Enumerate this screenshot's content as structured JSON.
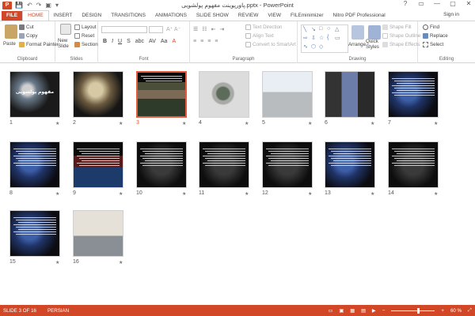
{
  "window": {
    "title": "پاورپوینت مفهوم پولشویی.pptx - PowerPoint",
    "app_badge": "P",
    "signin": "Sign in",
    "controls": [
      "?",
      "▭",
      "—",
      "▢",
      "✕"
    ]
  },
  "qat": [
    "💾",
    "↶",
    "↷",
    "▣",
    "▾"
  ],
  "tabs": [
    {
      "label": "FILE"
    },
    {
      "label": "HOME"
    },
    {
      "label": "INSERT"
    },
    {
      "label": "DESIGN"
    },
    {
      "label": "TRANSITIONS"
    },
    {
      "label": "ANIMATIONS"
    },
    {
      "label": "SLIDE SHOW"
    },
    {
      "label": "REVIEW"
    },
    {
      "label": "VIEW"
    },
    {
      "label": "FILEminimizer"
    },
    {
      "label": "Nitro PDF Professional"
    }
  ],
  "ribbon": {
    "clipboard": {
      "label": "Clipboard",
      "paste": "Paste",
      "cut": "Cut",
      "copy": "Copy",
      "format_painter": "Format Painter"
    },
    "slides": {
      "label": "Slides",
      "new_slide": "New Slide",
      "layout": "Layout",
      "reset": "Reset",
      "section": "Section"
    },
    "font": {
      "label": "Font",
      "buttons": [
        "B",
        "I",
        "U",
        "S",
        "abc",
        "AV",
        "Aa",
        "A"
      ]
    },
    "paragraph": {
      "label": "Paragraph",
      "text_direction": "Text Direction",
      "align_text": "Align Text",
      "convert_smartart": "Convert to SmartArt"
    },
    "drawing": {
      "label": "Drawing",
      "arrange": "Arrange",
      "quick_styles": "Quick Styles",
      "shape_fill": "Shape Fill",
      "shape_outline": "Shape Outline",
      "shape_effects": "Shape Effects"
    },
    "editing": {
      "label": "Editing",
      "find": "Find",
      "replace": "Replace",
      "select": "Select"
    }
  },
  "slides": [
    {
      "number": "1",
      "style": "coins",
      "title": "مفهوم پولشویی"
    },
    {
      "number": "2",
      "style": "money",
      "title": ""
    },
    {
      "number": "3",
      "style": "crowd",
      "title": "",
      "selected": true
    },
    {
      "number": "4",
      "style": "washer",
      "title": ""
    },
    {
      "number": "5",
      "style": "washer2",
      "title": ""
    },
    {
      "number": "6",
      "style": "collage",
      "title": ""
    },
    {
      "number": "7",
      "style": "bluetext",
      "title": ""
    },
    {
      "number": "8",
      "style": "bluetext",
      "title": ""
    },
    {
      "number": "9",
      "style": "redtext",
      "title": ""
    },
    {
      "number": "10",
      "style": "darktext",
      "title": ""
    },
    {
      "number": "11",
      "style": "darktext",
      "title": ""
    },
    {
      "number": "12",
      "style": "darktext",
      "title": ""
    },
    {
      "number": "13",
      "style": "bluetext",
      "title": ""
    },
    {
      "number": "14",
      "style": "darktext",
      "title": ""
    },
    {
      "number": "15",
      "style": "bluetext",
      "title": ""
    },
    {
      "number": "16",
      "style": "laptop",
      "title": ""
    }
  ],
  "status": {
    "slide_info": "SLIDE 3 OF 16",
    "language": "PERSIAN",
    "zoom": "60 %",
    "zoom_fraction": 0.6
  },
  "colors": {
    "accent": "#d24726",
    "selection": "#e25c3b"
  }
}
